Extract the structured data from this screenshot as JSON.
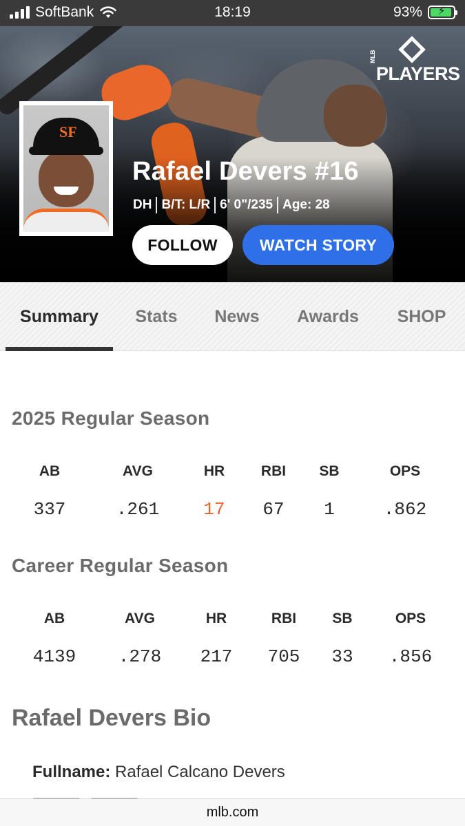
{
  "status_bar": {
    "carrier": "SoftBank",
    "time": "18:19",
    "battery_percent": "93%",
    "battery_level": 0.93,
    "battery_color": "#4cd964"
  },
  "hero": {
    "logo_prefix": "MLB",
    "logo_text": "PLAYERS",
    "player_name": "Rafael Devers #16",
    "meta": {
      "position": "DH",
      "bats_throws": "B/T: L/R",
      "height_weight": "6' 0\"/235",
      "age": "Age: 28"
    },
    "follow_label": "FOLLOW",
    "watch_label": "WATCH STORY",
    "accent_color": "#2f6fe8",
    "team_color": "#f26b21"
  },
  "tabs": [
    {
      "label": "Summary",
      "active": true
    },
    {
      "label": "Stats",
      "active": false
    },
    {
      "label": "News",
      "active": false
    },
    {
      "label": "Awards",
      "active": false
    },
    {
      "label": "SHOP",
      "active": false
    }
  ],
  "season": {
    "title": "2025 Regular Season",
    "headers": [
      "AB",
      "AVG",
      "HR",
      "RBI",
      "SB",
      "OPS"
    ],
    "values": [
      "337",
      ".261",
      "17",
      "67",
      "1",
      ".862"
    ],
    "highlight_color": "#e8622a"
  },
  "career": {
    "title": "Career Regular Season",
    "headers": [
      "AB",
      "AVG",
      "HR",
      "RBI",
      "SB",
      "OPS"
    ],
    "values": [
      "4139",
      ".278",
      "217",
      "705",
      "33",
      ".856"
    ]
  },
  "bio": {
    "title": "Rafael Devers Bio",
    "fullname_label": "Fullname:",
    "fullname_value": "Rafael Calcano Devers"
  },
  "browser": {
    "url": "mlb.com"
  }
}
